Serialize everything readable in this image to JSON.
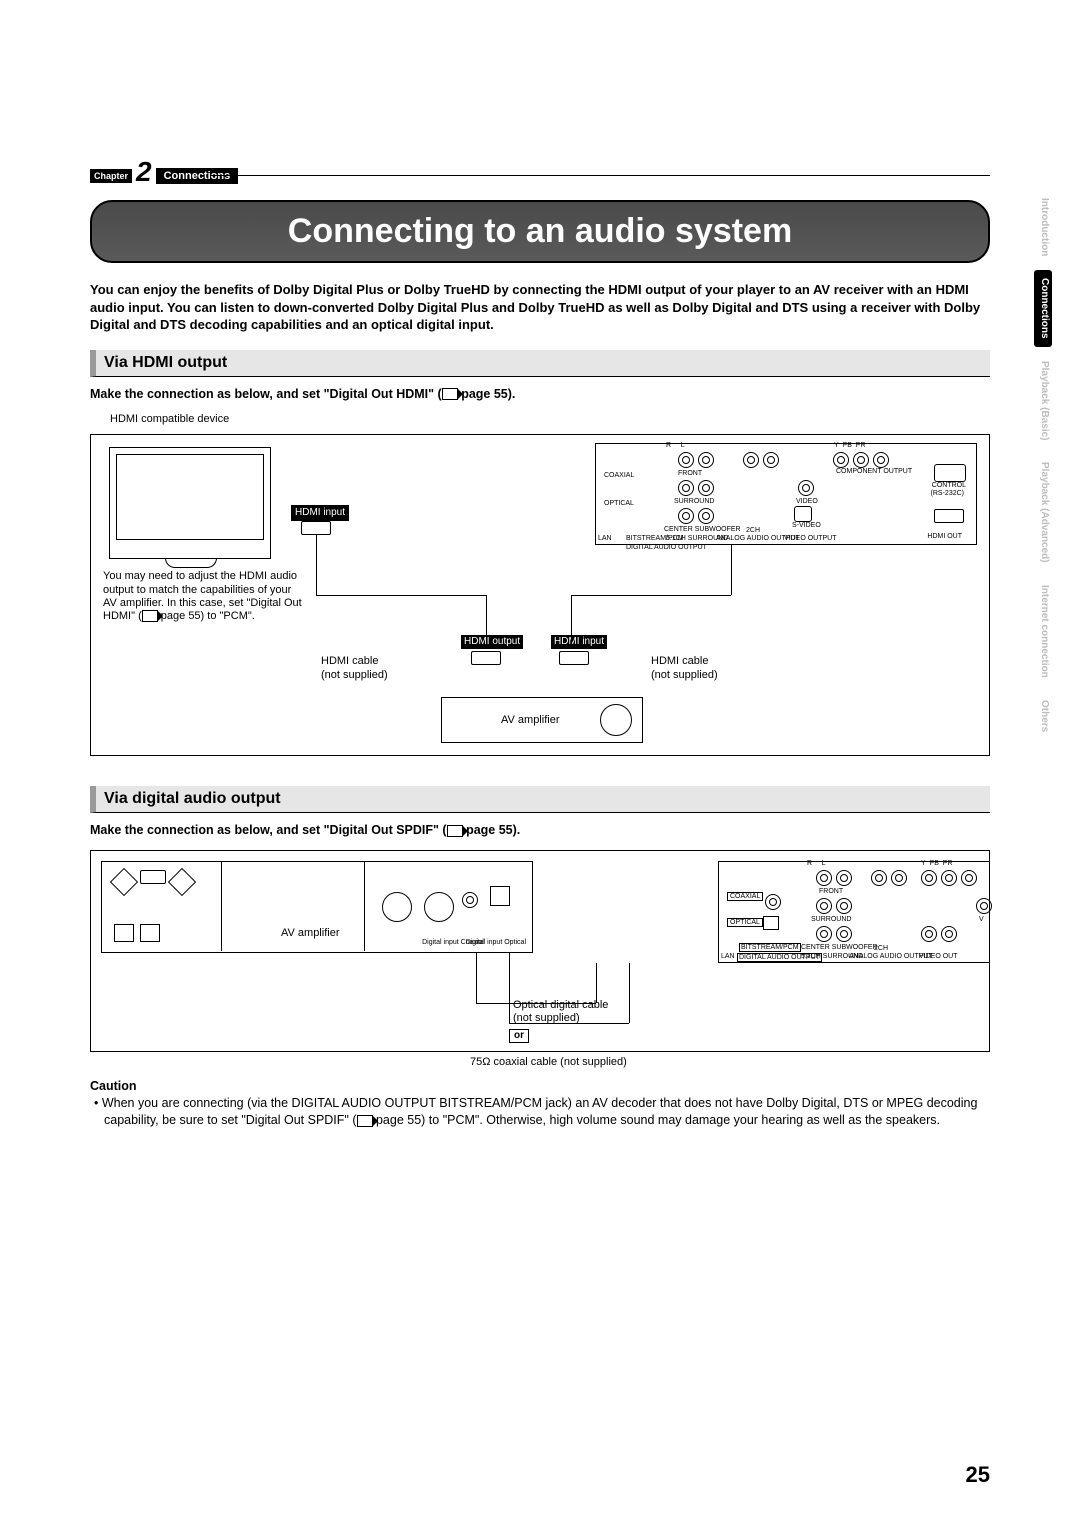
{
  "chapter": {
    "label": "Chapter",
    "number": "2",
    "name": "Connections"
  },
  "title": "Connecting to an audio system",
  "intro": "You can enjoy the benefits of Dolby Digital Plus or Dolby TrueHD by connecting the HDMI output of your player to an AV receiver with an HDMI audio input. You can listen to down-converted Dolby Digital Plus and Dolby TrueHD as well as Dolby Digital and DTS using a receiver with Dolby Digital and DTS decoding capabilities and an optical digital input.",
  "section1": {
    "heading": "Via HDMI output",
    "instruction_pre": "Make the connection as below, and set \"Digital Out HDMI\" (",
    "instruction_post": " page 55).",
    "labels": {
      "hdmi_device": "HDMI compatible device",
      "hdmi_input": "HDMI input",
      "note": "You may need to adjust the HDMI audio output to match the capabilities of your AV amplifier. In this case, set \"Digital Out HDMI\" (",
      "note_post": " page 55) to \"PCM\".",
      "hdmi_cable1": "HDMI cable\n(not supplied)",
      "hdmi_output": "HDMI output",
      "hdmi_input2": "HDMI input",
      "hdmi_cable2": "HDMI cable\n(not supplied)",
      "av_amp": "AV amplifier",
      "panel_ports": {
        "coaxial": "COAXIAL",
        "optical": "OPTICAL",
        "lan": "LAN",
        "bitstream": "BITSTREAM/PCM",
        "digital_audio_output": "DIGITAL AUDIO OUTPUT",
        "front": "FRONT",
        "surround": "SURROUND",
        "center_sub": "CENTER SUBWOOFER",
        "fiveone": "5.1CH SURROUND",
        "twoch": "2CH",
        "analog_audio": "ANALOG AUDIO OUTPUT",
        "video": "VIDEO",
        "svideo": "S-VIDEO",
        "video_output": "VIDEO OUTPUT",
        "component": "COMPONENT OUTPUT",
        "y": "Y",
        "pb": "PB",
        "pr": "PR",
        "r": "R",
        "l": "L",
        "control": "CONTROL",
        "rs232": "(RS-232C)",
        "hdmi_out": "HDMI OUT"
      }
    }
  },
  "section2": {
    "heading": "Via digital audio output",
    "instruction_pre": "Make the connection as below, and set \"Digital Out SPDIF\" (",
    "instruction_post": " page 55).",
    "labels": {
      "av_amp": "AV amplifier",
      "dig_in_coax": "Digital input Coaxial",
      "dig_in_opt": "Digital input Optical",
      "optical_cable": "Optical digital cable\n(not supplied)",
      "or": "or",
      "coax_cable": "75Ω coaxial cable (not supplied)",
      "panel": {
        "coaxial": "COAXIAL",
        "optical": "OPTICAL",
        "lan": "LAN",
        "bitstream": "BITSTREAM/PCM",
        "digital_audio_output": "DIGITAL AUDIO OUTPUT",
        "front": "FRONT",
        "surround": "SURROUND",
        "center_sub": "CENTER SUBWOOFER",
        "fiveone": "5.1CH SURROUND",
        "twoch": "2CH",
        "analog_audio": "ANALOG AUDIO OUTPUT",
        "video_out": "VIDEO OUT",
        "r": "R",
        "l": "L",
        "y": "Y",
        "pb": "PB",
        "pr": "PR",
        "v": "V"
      }
    }
  },
  "caution": {
    "heading": "Caution",
    "bullet": "• When you are connecting (via the DIGITAL AUDIO OUTPUT BITSTREAM/PCM jack) an AV decoder that does not have Dolby Digital, DTS or MPEG decoding capability, be sure to set \"Digital Out SPDIF\" (",
    "bullet_post": " page 55) to \"PCM\". Otherwise, high volume sound may damage your hearing as well as the speakers."
  },
  "side_tabs": [
    "Introduction",
    "Connections",
    "Playback (Basic)",
    "Playback (Advanced)",
    "Internet connection",
    "Others"
  ],
  "page_number": "25"
}
